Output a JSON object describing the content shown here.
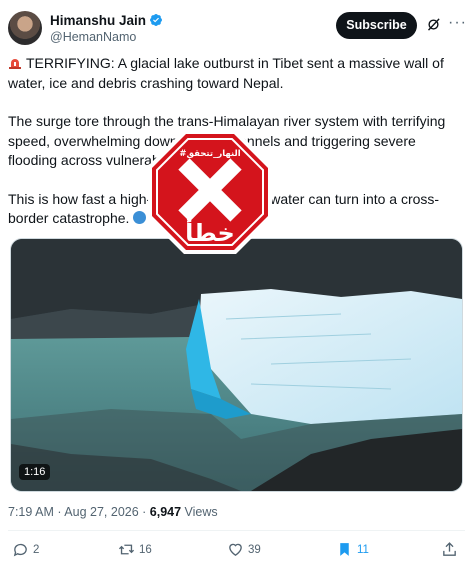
{
  "author": {
    "name": "Himanshu Jain",
    "handle": "@HemanNamo"
  },
  "header": {
    "subscribe_label": "Subscribe",
    "more_label": "···"
  },
  "post": {
    "paragraph1": "TERRIFYING: A glacial lake outburst in Tibet sent a massive wall of water, ice and debris crashing toward Nepal.",
    "paragraph2": "The surge tore through the trans-Himalayan river system with terrifying speed, overwhelming downstream channels and triggering severe flooding across vulnerable areas.",
    "paragraph3": "This is how fast a high-altitude glacial meltwater can turn into a cross-border catastrophe."
  },
  "media": {
    "duration": "1:16"
  },
  "overlay": {
    "stamp_text": "خطأ",
    "stamp_source": "#النهار_تتحقق",
    "stamp_color": "#d4141c"
  },
  "meta": {
    "time": "7:19 AM",
    "date": "Aug 27, 2026",
    "views_count": "6,947",
    "views_label": "Views"
  },
  "actions": {
    "replies": "2",
    "reposts": "16",
    "likes": "39",
    "bookmarks": "11"
  },
  "colors": {
    "accent": "#1d9bf0",
    "text": "#0f1419",
    "muted": "#536471"
  },
  "icons": [
    "verified-badge-icon",
    "grok-icon",
    "siren-icon",
    "reply-icon",
    "repost-icon",
    "like-icon",
    "bookmark-icon",
    "share-icon"
  ]
}
